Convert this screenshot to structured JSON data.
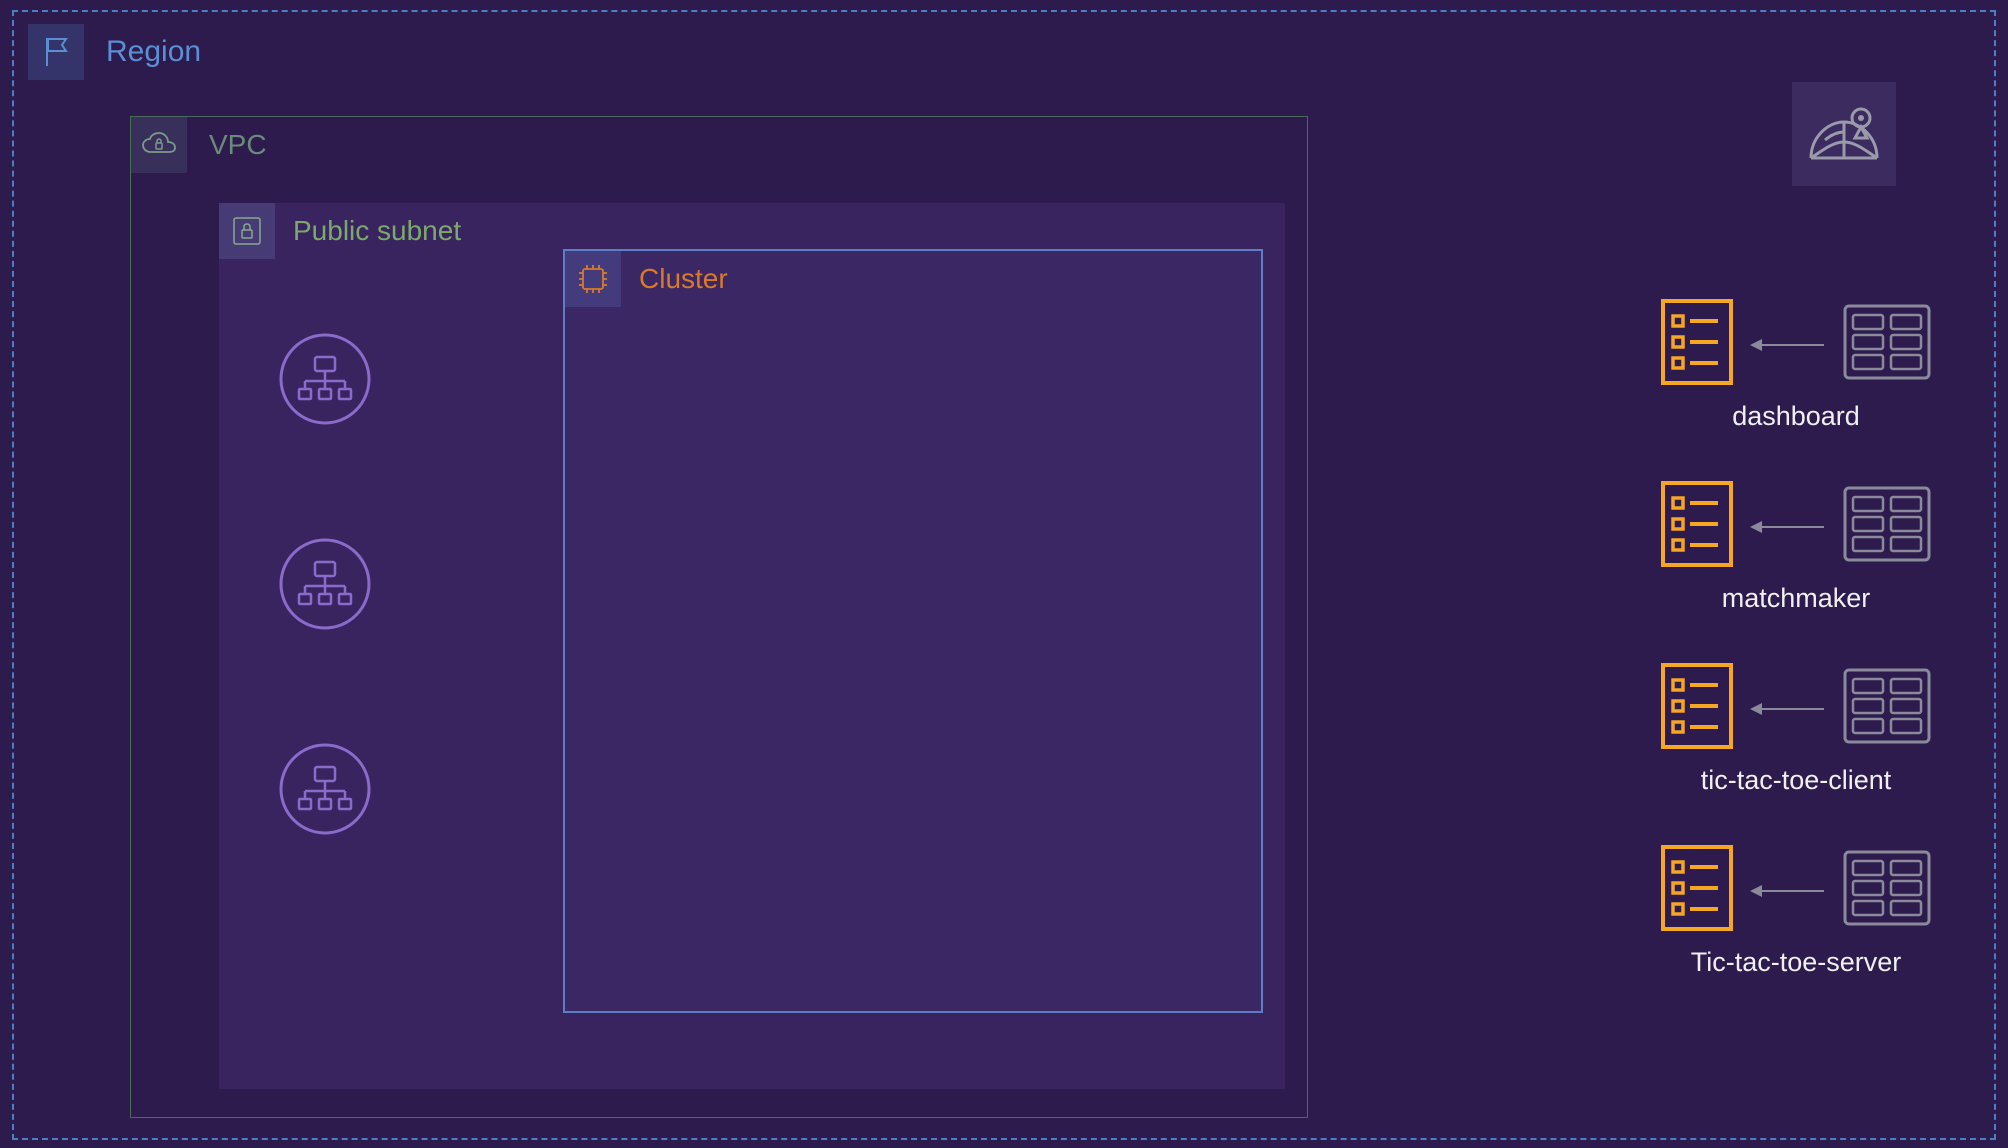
{
  "region": {
    "label": "Region"
  },
  "vpc": {
    "label": "VPC"
  },
  "subnet": {
    "label": "Public subnet"
  },
  "cluster": {
    "label": "Cluster"
  },
  "services": [
    {
      "label": "dashboard"
    },
    {
      "label": "matchmaker"
    },
    {
      "label": "tic-tac-toe-client"
    },
    {
      "label": "Tic-tac-toe-server"
    }
  ],
  "colors": {
    "region_border": "#4a7fc4",
    "subnet_bg": "rgba(120,80,180,0.18)",
    "cluster_border": "#5a7fc4",
    "service_accent": "#f5a623",
    "grid_stroke": "#8a8a9a"
  }
}
